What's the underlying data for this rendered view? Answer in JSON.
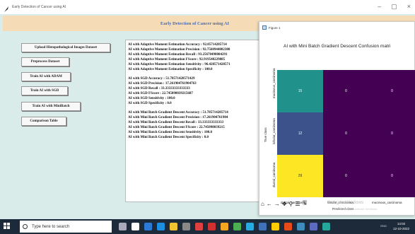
{
  "app": {
    "title": "Early Detection of Cancer using AI",
    "banner": "Early Detection of Cancer using AI",
    "controls": {
      "minimize": "–",
      "maximize": "▢",
      "close": "×"
    }
  },
  "buttons": {
    "upload": "Upload Histopathological Images Dataset",
    "preprocess": "Preprocess Dataset",
    "adam": "Train AI with ADAM",
    "sgd": "Train AI with SGD",
    "minibatch": "Train AI with MiniBatch",
    "comparison": "Comparison Table"
  },
  "output_lines": {
    "l1": "AI with Adaptive Moment Estimation Accuracy  :  92.85714285714",
    "l2": "AI with Adaptive Moment Estimation Precision  :  92.7560944802380",
    "l3": "AI with Adaptive Moment Estimation Recall  :  93.25670498084291",
    "l4": "AI with Adaptive Moment Estimation FScore  :  92.919540229885",
    "l5": "AI with Adaptive Moment Estimation Sensitivity : 96.428571428571",
    "l6": "AI with Adaptive Moment Estimation Specificity : 100.0",
    "l7": "AI with SGD Accuracy  :  51.78571428571429",
    "l8": "AI with SGD Precision  :  17.261904761904763",
    "l9": "AI with SGD Recall  :  33.33333333333333",
    "l10": "AI with SGD FScore  :  22.745098039215687",
    "l11": "AI with SGD Sensitivity : 100.0",
    "l12": "AI with SGD Specificity : 0.0",
    "l13": "AI with Mini Batch Gradient Descent Accuracy  :  51.785714285714",
    "l14": "AI with Mini Batch Gradient Descent Precision  :  17.261904761904",
    "l15": "AI with Mini Batch Gradient Descent Recall  :  33.333333333333",
    "l16": "AI with Mini Batch Gradient Descent FScore  :  22.745098039215",
    "l17": "AI with Mini Batch Gradient Descent Sensitivity : 100.0",
    "l18": "AI with Mini Batch Gradient Descent Specificity : 0.0"
  },
  "figure": {
    "window_title": "Figure 1",
    "toolbar_icons": [
      "home-icon",
      "back-icon",
      "forward-icon",
      "pan-icon",
      "zoom-icon",
      "configure-icon",
      "save-icon"
    ],
    "toolbar_glyphs": {
      "home": "⌂",
      "back": "←",
      "forward": "→",
      "pan": "✥",
      "zoom": "⚲",
      "configure": "☰",
      "save": "🖫"
    },
    "watermark": "Activate Windows",
    "watermark_sub": "Go to Settings to activate Windows."
  },
  "chart_data": {
    "type": "heatmap",
    "title": "AI with Mini Batch Gradient Descent Confusion matri",
    "xlabel": "Predicted class",
    "ylabel": "True class",
    "x_categories": [
      "ductal_carcinoma",
      "lobular_carcinoma",
      "mucinous_carcinoma"
    ],
    "y_categories": [
      "mucinous_carcinoma",
      "lobular_carcinoma",
      "ductal_carcinoma"
    ],
    "values": [
      [
        15,
        0,
        0
      ],
      [
        12,
        0,
        0
      ],
      [
        29,
        0,
        0
      ]
    ],
    "value_labels": [
      [
        "15",
        "0",
        "0"
      ],
      [
        "12",
        "0",
        "0"
      ],
      [
        "29",
        "0",
        "0"
      ]
    ],
    "colormap": "viridis",
    "colors": {
      "high": "#fde725",
      "mid_high": "#21918c",
      "mid_low": "#3b528b",
      "low": "#440154"
    }
  },
  "taskbar": {
    "search_placeholder": "Type here to search",
    "tray_text": "ENG",
    "time": "14:02",
    "date": "12-10-2022"
  }
}
